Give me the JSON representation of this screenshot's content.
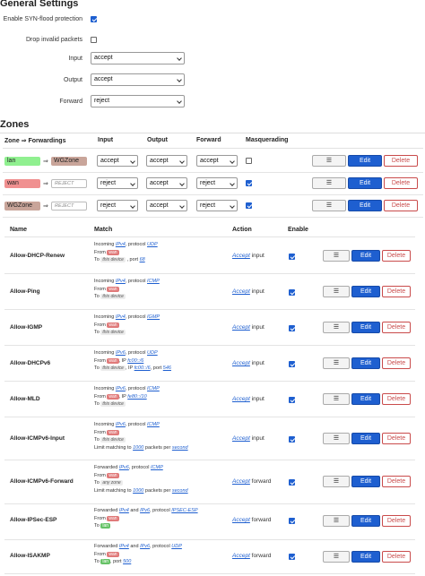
{
  "general": {
    "title": "General Settings",
    "syn_label": "Enable SYN-flood protection",
    "syn_checked": true,
    "drop_label": "Drop invalid packets",
    "drop_checked": false,
    "input_label": "Input",
    "input_value": "accept",
    "output_label": "Output",
    "output_value": "accept",
    "forward_label": "Forward",
    "forward_value": "reject"
  },
  "zones": {
    "title": "Zones",
    "headers": {
      "zone": "Zone ⇒ Forwardings",
      "input": "Input",
      "output": "Output",
      "forward": "Forward",
      "masq": "Masquerading"
    },
    "rows": [
      {
        "name": "lan",
        "target": "WGZone",
        "input": "accept",
        "output": "accept",
        "forward": "accept",
        "masq": false
      },
      {
        "name": "wan",
        "target": "REJECT",
        "input": "reject",
        "output": "accept",
        "forward": "reject",
        "masq": true
      },
      {
        "name": "WGZone",
        "target": "REJECT",
        "input": "reject",
        "output": "accept",
        "forward": "reject",
        "masq": true
      }
    ],
    "arrow": "⇒",
    "menu_label": "☰",
    "edit_label": "Edit",
    "delete_label": "Delete"
  },
  "rules": {
    "headers": {
      "name": "Name",
      "match": "Match",
      "action": "Action",
      "enable": "Enable"
    },
    "rows": [
      {
        "name": "Allow-DHCP-Renew",
        "l1a": "Incoming ",
        "l1b": "IPv4",
        "l1c": ", protocol ",
        "l1d": "UDP",
        "l2a": "From ",
        "l2p": "wan",
        "l3a": "To ",
        "l3p": "this device",
        "l3b": " , port ",
        "l3c": "68",
        "act": "Accept",
        "act2": " input"
      },
      {
        "name": "Allow-Ping",
        "l1a": "Incoming ",
        "l1b": "IPv4",
        "l1c": ", protocol ",
        "l1d": "ICMP",
        "l2a": "From ",
        "l2p": "wan",
        "l3a": "To ",
        "l3p": "this device",
        "act": "Accept",
        "act2": " input"
      },
      {
        "name": "Allow-IGMP",
        "l1a": "Incoming ",
        "l1b": "IPv4",
        "l1c": ", protocol ",
        "l1d": "IGMP",
        "l2a": "From ",
        "l2p": "wan",
        "l3a": "To ",
        "l3p": "this device",
        "act": "Accept",
        "act2": " input"
      },
      {
        "name": "Allow-DHCPv6",
        "l1a": "Incoming ",
        "l1b": "IPv6",
        "l1c": ", protocol ",
        "l1d": "UDP",
        "l2a": "From ",
        "l2p": "wan",
        "l2b": ", IP ",
        "l2c": "fc00::/6",
        "l3a": "To ",
        "l3p": "this device",
        "l3b": ", IP ",
        "l3c": "fc00::/6",
        "l3d": ", port ",
        "l3e": "546",
        "act": "Accept",
        "act2": " input"
      },
      {
        "name": "Allow-MLD",
        "l1a": "Incoming ",
        "l1b": "IPv6",
        "l1c": ", protocol ",
        "l1d": "ICMP",
        "l2a": "From ",
        "l2p": "wan",
        "l2b": ", IP ",
        "l2c": "fe80::/10",
        "l3a": "To ",
        "l3p": "this device",
        "act": "Accept",
        "act2": " input"
      },
      {
        "name": "Allow-ICMPv6-Input",
        "l1a": "Incoming ",
        "l1b": "IPv6",
        "l1c": ", protocol ",
        "l1d": "ICMP",
        "l2a": "From ",
        "l2p": "wan",
        "l3a": "To ",
        "l3p": "this device",
        "l4a": "Limit matching to ",
        "l4b": "1000",
        "l4c": " packets per ",
        "l4d": "second",
        "act": "Accept",
        "act2": " input"
      },
      {
        "name": "Allow-ICMPv6-Forward",
        "l1a": "Forwarded ",
        "l1b": "IPv6",
        "l1c": ", protocol ",
        "l1d": "ICMP",
        "l2a": "From ",
        "l2p": "wan",
        "l3a": "To ",
        "l3p": "any zone",
        "l4a": "Limit matching to ",
        "l4b": "1000",
        "l4c": " packets per ",
        "l4d": "second",
        "act": "Accept",
        "act2": " forward"
      },
      {
        "name": "Allow-IPSec-ESP",
        "l1a": "Forwarded ",
        "l1b": "IPv4",
        "l1c": " and ",
        "l1d": "IPv6",
        "l1e": ", protocol ",
        "l1f": "IPSEC-ESP",
        "l2a": "From ",
        "l2p": "wan",
        "l3a": "To ",
        "l3p": "lan",
        "act": "Accept",
        "act2": " forward"
      },
      {
        "name": "Allow-ISAKMP",
        "l1a": "Forwarded ",
        "l1b": "IPv4",
        "l1c": " and ",
        "l1d": "IPv6",
        "l1e": ", protocol ",
        "l1f": "UDP",
        "l2a": "From ",
        "l2p": "wan",
        "l3a": "To ",
        "l3p": "lan",
        "l3b": ", port ",
        "l3c": "500",
        "act": "Accept",
        "act2": " forward"
      }
    ]
  }
}
